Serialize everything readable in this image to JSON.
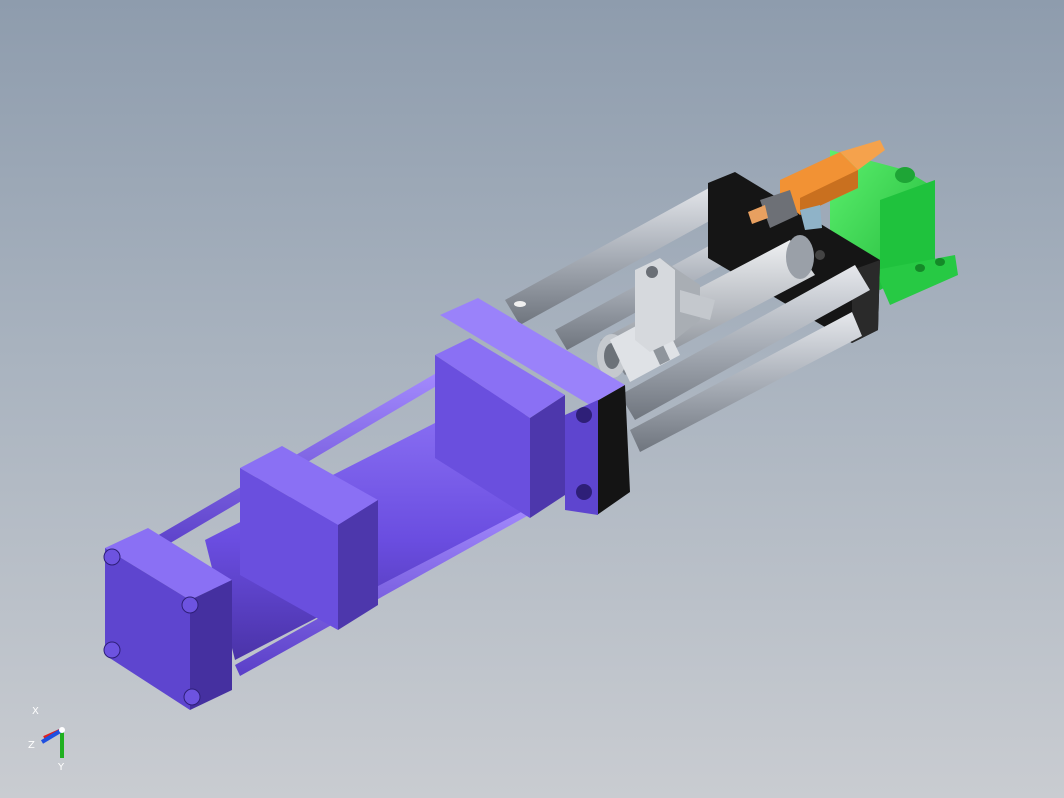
{
  "colors": {
    "cylinder": "#7b5bea",
    "cylinder_dark": "#5b3fc4",
    "cylinder_side": "#4a33a3",
    "rod": "#b9bec6",
    "black_plate": "#1a1a1a",
    "motor": "#2fd64a",
    "sensor": "#ef8c2c"
  },
  "triad": {
    "x_label": "X",
    "y_label": "Y",
    "z_label": "Z",
    "x_color": "#e02020",
    "y_color": "#20b020",
    "z_color": "#2050e0"
  }
}
